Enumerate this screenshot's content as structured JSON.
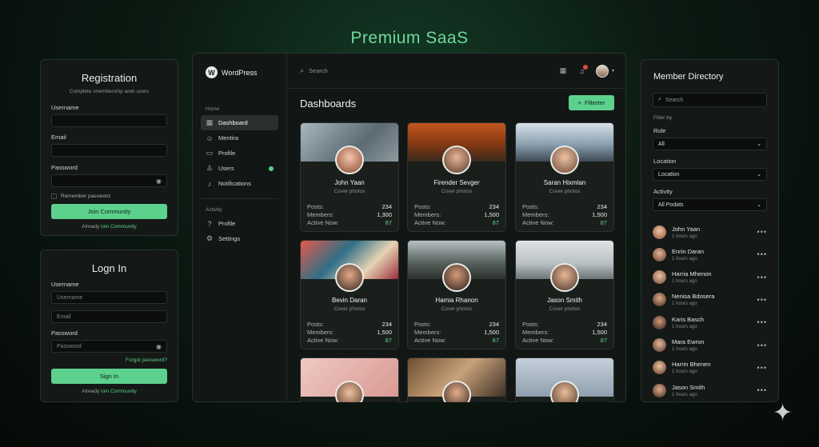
{
  "page_title": "Premium SaaS",
  "registration": {
    "title": "Registration",
    "subtitle": "Complete ımembership areb users",
    "username_label": "Username",
    "email_label": "Email",
    "password_label": "Password",
    "remember_label": "Remember password",
    "join_button": "Join Community",
    "already_text": "Already",
    "already_link": "ioin Community"
  },
  "login": {
    "title": "Logn In",
    "username_label": "Username",
    "username_placeholder": "Username",
    "email_placeholder": "Email",
    "password_label": "Password",
    "password_placeholder": "Password",
    "forgot": "Forgot password?",
    "signin_button": "Sign In",
    "already_text": "Already",
    "already_link": "ioin Community"
  },
  "app": {
    "brand": "WordPress",
    "search_placeholder": "Search",
    "notif_count": "",
    "section_home": "Home",
    "section_activity": "Activity",
    "nav": [
      {
        "label": "Dashboard",
        "icon": "grid-icon"
      },
      {
        "label": "Mentira",
        "icon": "users-icon"
      },
      {
        "label": "Profile",
        "icon": "file-icon"
      },
      {
        "label": "Users",
        "icon": "user-icon"
      },
      {
        "label": "Notifications",
        "icon": "bell-icon"
      }
    ],
    "nav2": [
      {
        "label": "Profile",
        "icon": "help-icon"
      },
      {
        "label": "Settings",
        "icon": "gear-icon"
      }
    ],
    "heading": "Dashboards",
    "filter_button": "Filterter"
  },
  "cards": [
    {
      "name": "John Yaan",
      "sub": "Cover photos",
      "posts": "234",
      "members": "1,300",
      "active": "87"
    },
    {
      "name": "Firender Sevger",
      "sub": "Cover photos",
      "posts": "234",
      "members": "1,500",
      "active": "87"
    },
    {
      "name": "Saran Hixmlan",
      "sub": "Cover photos",
      "posts": "234",
      "members": "1,500",
      "active": "87"
    },
    {
      "name": "Bevin Daran",
      "sub": "Cover photos",
      "posts": "234",
      "members": "1,500",
      "active": "87"
    },
    {
      "name": "Hamia Rhanon",
      "sub": "Cover photos",
      "posts": "234",
      "members": "1,500",
      "active": "87"
    },
    {
      "name": "Jason Smith",
      "sub": "Cover photos",
      "posts": "234",
      "members": "1,500",
      "active": "87"
    }
  ],
  "card_labels": {
    "posts": "Posts:",
    "members": "Members:",
    "active": "Active Now:"
  },
  "directory": {
    "title": "Member Directory",
    "search_placeholder": "Search",
    "filter_by": "Filter by",
    "role_label": "Role",
    "role_value": "All",
    "location_label": "Location",
    "location_value": "Location",
    "activity_label": "Activity",
    "activity_value": "All Podats",
    "members": [
      {
        "name": "John Yaan",
        "time": "1 hours ago"
      },
      {
        "name": "Enrin Daran",
        "time": "1 hours ago"
      },
      {
        "name": "Harria Mhenon",
        "time": "1 hours ago"
      },
      {
        "name": "Nenisa Bdosera",
        "time": "1 hours ago"
      },
      {
        "name": "Karis Basch",
        "time": "1 hours ago"
      },
      {
        "name": "Mara Ewron",
        "time": "1 hours ago"
      },
      {
        "name": "Harrin Bhenen",
        "time": "1 hours ago"
      },
      {
        "name": "Jason Smith",
        "time": "1 hours ago"
      }
    ]
  }
}
